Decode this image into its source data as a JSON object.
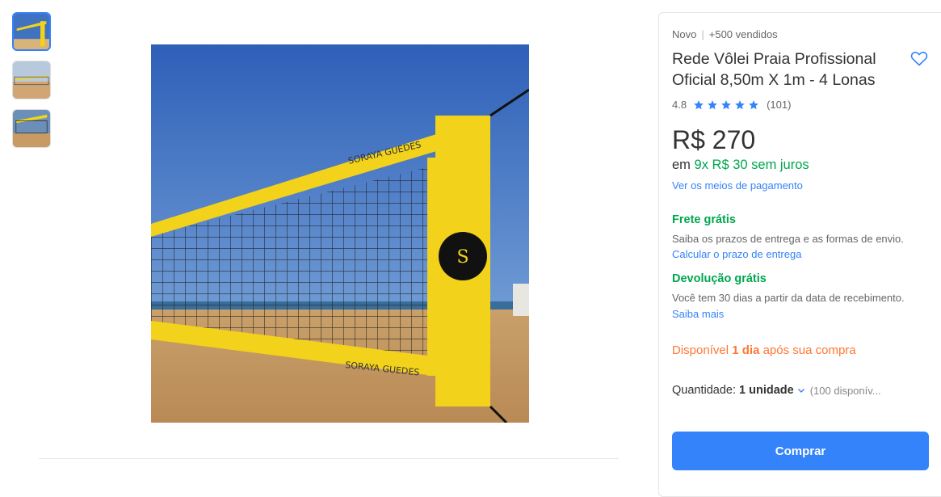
{
  "gallery": {
    "thumbnails": [
      "thumbnail-net-yellow",
      "thumbnail-beach-net",
      "thumbnail-net-closeup"
    ],
    "main_image_logo_text": "SORAYA GUEDES"
  },
  "product": {
    "condition": "Novo",
    "sold": "+500 vendidos",
    "title": "Rede Vôlei Praia Profissional Oficial 8,50m X 1m - 4 Lonas",
    "rating": "4.8",
    "stars": 5,
    "reviews": "(101)",
    "price": "R$ 270",
    "installments_prefix": "em",
    "installments_value": "9x R$ 30 sem juros",
    "payment_link": "Ver os meios de pagamento"
  },
  "shipping": {
    "title": "Frete grátis",
    "desc": "Saiba os prazos de entrega e as formas de envio.",
    "link": "Calcular o prazo de entrega"
  },
  "returns": {
    "title": "Devolução grátis",
    "desc": "Você tem 30 dias a partir da data de recebimento.",
    "link": "Saiba mais"
  },
  "availability": {
    "prefix": "Disponível",
    "bold": "1 dia",
    "suffix": "após sua compra"
  },
  "quantity": {
    "label": "Quantidade:",
    "value": "1 unidade",
    "stock": "(100 disponív..."
  },
  "buy_button": "Comprar",
  "colors": {
    "accent": "#3483fa",
    "green": "#00a650",
    "orange": "#ff7733"
  }
}
